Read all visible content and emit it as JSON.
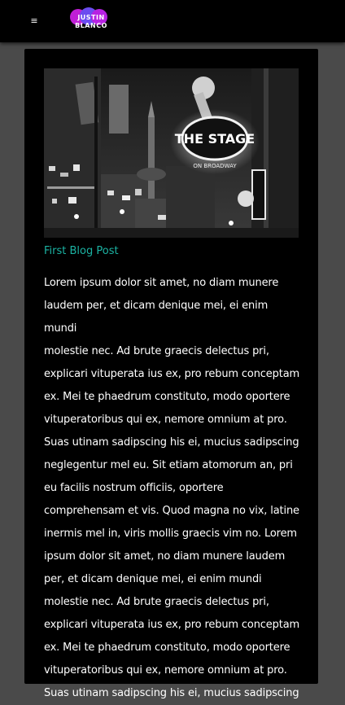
{
  "header": {
    "menu_icon": "hamburger-icon",
    "menu_glyph": "≡",
    "logo": {
      "line1": "JUSTIN",
      "line2": "BLANCO"
    }
  },
  "post": {
    "image_alt": "Black and white night street scene with neon sign THE STAGE ON BROADWAY",
    "sign_text": "THE STAGE",
    "sign_sub": "ON BROADWAY",
    "title": "First Blog Post",
    "body": "Lorem ipsum dolor sit amet, no diam munere\nlaudem per, et dicam denique mei, ei enim mundi\nmolestie nec. Ad brute graecis delectus pri,\nexplicari vituperata ius ex, pro rebum conceptam\nex. Mei te phaedrum constituto, modo oportere\nvituperatoribus qui ex, nemore omnium at pro.\nSuas utinam sadipscing his ei, mucius sadipscing\nneglegentur mel eu. Sit etiam atomorum an, pri\neu facilis nostrum officiis, oportere\ncomprehensam et vis. Quod magna no vix, latine\ninermis mel in, viris mollis graecis vim no. Lorem\nipsum dolor sit amet, no diam munere laudem\nper, et dicam denique mei, ei enim mundi\nmolestie nec. Ad brute graecis delectus pri,\nexplicari vituperata ius ex, pro rebum conceptam\nex. Mei te phaedrum constituto, modo oportere\nvituperatoribus qui ex, nemore omnium at pro.\nSuas utinam sadipscing his ei, mucius sadipscing"
  },
  "colors": {
    "page_bg": "#4a4a4a",
    "card_bg": "#000000",
    "accent": "#1bb3a3",
    "logo_magenta": "#c01fd6",
    "logo_violet": "#6b4cf0"
  }
}
